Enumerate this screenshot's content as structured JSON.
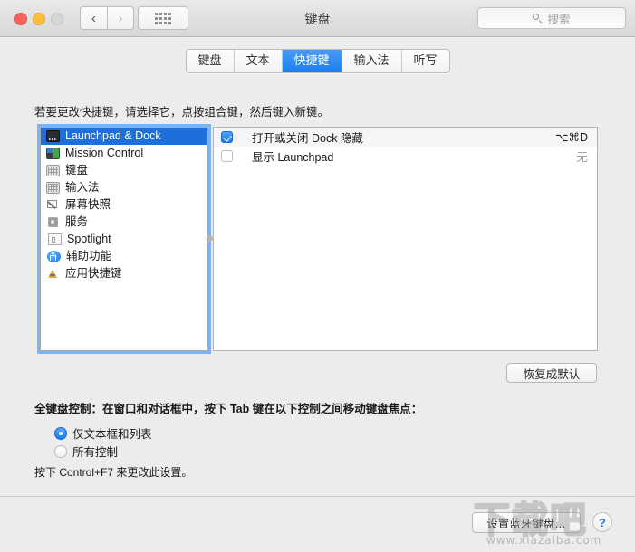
{
  "window": {
    "title": "键盘",
    "traffic_lights": [
      "close",
      "minimize",
      "zoom"
    ],
    "nav_back_icon": "chevron-left-icon",
    "nav_forward_icon": "chevron-right-icon",
    "grid_icon": "grid-apps-icon"
  },
  "search": {
    "icon": "search-icon",
    "placeholder": "搜索",
    "value": ""
  },
  "tabs": [
    {
      "label": "键盘",
      "selected": false
    },
    {
      "label": "文本",
      "selected": false
    },
    {
      "label": "快捷键",
      "selected": true
    },
    {
      "label": "输入法",
      "selected": false
    },
    {
      "label": "听写",
      "selected": false
    }
  ],
  "content": {
    "instruction": "若要更改快捷键，请选择它，点按组合键，然后键入新键。",
    "restore_button": "恢复成默认"
  },
  "sidebar": {
    "items": [
      {
        "label": "Launchpad & Dock",
        "icon": "launchpad-dock-icon",
        "selected": true
      },
      {
        "label": "Mission Control",
        "icon": "mission-control-icon",
        "selected": false
      },
      {
        "label": "键盘",
        "icon": "keyboard-icon",
        "selected": false
      },
      {
        "label": "输入法",
        "icon": "input-source-icon",
        "selected": false
      },
      {
        "label": "屏幕快照",
        "icon": "screenshot-icon",
        "selected": false
      },
      {
        "label": "服务",
        "icon": "services-gear-icon",
        "selected": false
      },
      {
        "label": "Spotlight",
        "icon": "spotlight-document-icon",
        "selected": false
      },
      {
        "label": "辅助功能",
        "icon": "accessibility-icon",
        "selected": false
      },
      {
        "label": "应用快捷键",
        "icon": "app-shortcuts-icon",
        "selected": false
      }
    ]
  },
  "shortcuts": {
    "rows": [
      {
        "name": "打开或关闭 Dock 隐藏",
        "key": "⌥⌘D",
        "checked": true,
        "key_is_none": false
      },
      {
        "name": "显示 Launchpad",
        "key": "无",
        "checked": false,
        "key_is_none": true
      }
    ]
  },
  "full_keyboard_access": {
    "label": "全键盘控制：在窗口和对话框中，按下 Tab 键在以下控制之间移动键盘焦点：",
    "options": [
      {
        "label": "仅文本框和列表",
        "selected": true
      },
      {
        "label": "所有控制",
        "selected": false
      }
    ],
    "hint": "按下 Control+F7 来更改此设置。"
  },
  "footer": {
    "bluetooth_button": "设置蓝牙键盘…",
    "help_button": "?"
  },
  "watermark": {
    "main": "下载吧",
    "sub": "www.xiazaiba.com"
  },
  "colors": {
    "accent_blue": "#1e6fd9",
    "tab_selected": "#1a7ef0",
    "window_bg": "#ececec",
    "panel_bg": "#ffffff"
  }
}
